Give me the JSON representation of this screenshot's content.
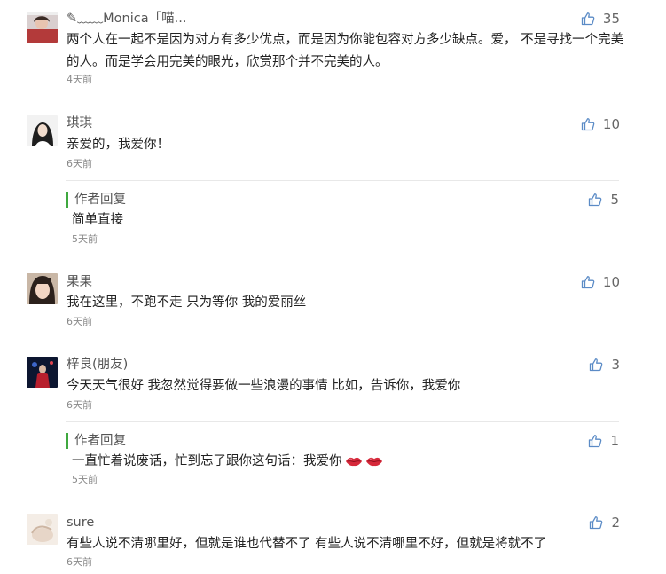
{
  "comments": [
    {
      "name": "✎﹏﹏Monica「喵...",
      "text": "两个人在一起不是因为对方有多少优点，而是因为你能包容对方多少缺点。爱， 不是寻找一个完美的人。而是学会用完美的眼光，欣赏那个并不完美的人。",
      "time": "4天前",
      "likes": "35",
      "avatar_icon": "avatar-photo-monica"
    },
    {
      "name": "琪琪",
      "text": "亲爱的，我爱你！",
      "time": "6天前",
      "likes": "10",
      "avatar_icon": "avatar-photo-qiqi",
      "reply": {
        "label": "作者回复",
        "text": "简单直接",
        "time": "5天前",
        "likes": "5"
      }
    },
    {
      "name": "果果",
      "text": "我在这里，不跑不走 只为等你 我的爱丽丝",
      "time": "6天前",
      "likes": "10",
      "avatar_icon": "avatar-photo-guoguo"
    },
    {
      "name": "梓良(朋友)",
      "text": "今天天气很好 我忽然觉得要做一些浪漫的事情 比如，告诉你，我爱你",
      "time": "6天前",
      "likes": "3",
      "avatar_icon": "avatar-photo-ziliang",
      "reply": {
        "label": "作者回复",
        "text": "一直忙着说废话，忙到忘了跟你这句话：我爱你",
        "time": "5天前",
        "likes": "1",
        "emoji": [
          "lips-icon",
          "lips-icon"
        ]
      }
    },
    {
      "name": "sure",
      "text": "有些人说不清哪里好，但就是谁也代替不了 有些人说不清哪里不好，但就是将就不了",
      "time": "6天前",
      "likes": "2",
      "avatar_icon": "avatar-photo-sure"
    }
  ],
  "colors": {
    "reply_accent": "#3fa83f",
    "like_icon": "#5b8bc6",
    "time": "#888888"
  }
}
